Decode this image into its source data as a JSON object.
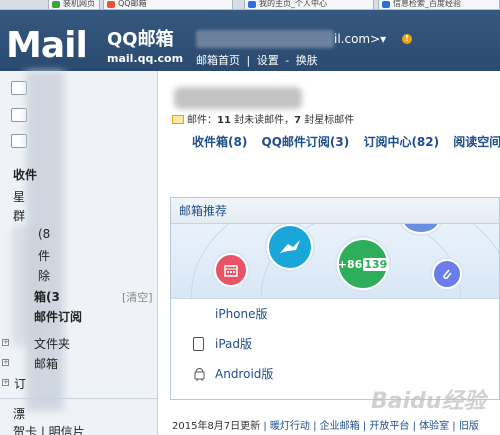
{
  "tabs": [
    {
      "label": "装机网页",
      "color": "#3aa63a"
    },
    {
      "label": "QQ邮箱",
      "color": "#e8533a"
    },
    {
      "label": "我的主页_个人中心",
      "color": "#2a6fdb"
    },
    {
      "label": "信息检索_百度经验",
      "color": "#2a6fdb"
    }
  ],
  "header": {
    "logo_text": "Mail",
    "logo_brand": "QQ邮箱",
    "logo_domain": "mail.qq.com",
    "user_email_suffix": "il.com>",
    "user_dropdown": "▾",
    "warning": "!",
    "links": [
      "邮箱首页",
      "|",
      "设置",
      "-",
      "换肤"
    ]
  },
  "sidebar": {
    "icons": [
      "compose-icon",
      "inbox-icon",
      "contacts-icon"
    ],
    "items": [
      {
        "label": "收件",
        "bold": true
      },
      {
        "label": "星",
        "bold": false
      },
      {
        "label": "群",
        "bold": false
      },
      {
        "label": "(8",
        "bold": false
      },
      {
        "label": "件",
        "bold": false
      },
      {
        "label": "除",
        "bold": false
      },
      {
        "label": "箱(3",
        "bold": true
      },
      {
        "label": "邮件订阅",
        "bold": true
      }
    ],
    "clear_label": "[清空]",
    "folders": [
      {
        "label": "文件夹"
      },
      {
        "label": "邮箱"
      },
      {
        "label": "订"
      }
    ],
    "bottom": [
      {
        "label": "漂"
      },
      {
        "label": "贺卡 | 明信片"
      }
    ]
  },
  "main": {
    "summary": {
      "prefix": "邮件：",
      "unread": "11",
      "unread_text": " 封未读邮件，",
      "starred": "7",
      "starred_text": " 封星标邮件"
    },
    "quick_links": [
      "收件箱(8)",
      "QQ邮件订阅(3)",
      "订阅中心(82)",
      "阅读空间"
    ],
    "recommend": {
      "title": "邮箱推荐",
      "phone_badge": "+86",
      "phone_num": "139",
      "list": [
        {
          "icon": "apple-icon",
          "label": "iPhone版"
        },
        {
          "icon": "ipad-icon",
          "label": "iPad版"
        },
        {
          "icon": "android-icon",
          "label": "Android版"
        }
      ]
    },
    "footer": {
      "update": "2015年8月7日更新",
      "links": [
        "暖灯行动",
        "企业邮箱",
        "开放平台",
        "体验室",
        "旧版"
      ]
    },
    "watermark": "Baidu经验"
  }
}
